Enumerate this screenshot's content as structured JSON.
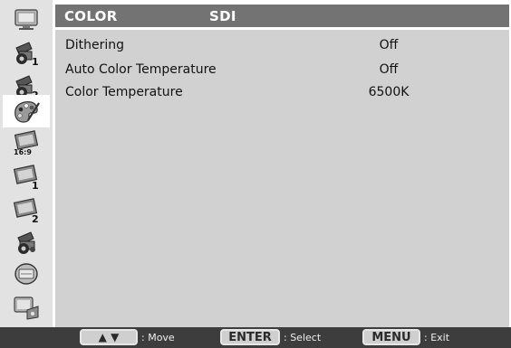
{
  "header": {
    "title": "COLOR",
    "source": "SDI"
  },
  "settings": [
    {
      "label": "Dithering",
      "value": "Off"
    },
    {
      "label": "Auto Color Temperature",
      "value": "Off"
    },
    {
      "label": "Color Temperature",
      "value": "6500K"
    }
  ],
  "sidebar": {
    "items": [
      {
        "icon": "monitor-icon",
        "badge": ""
      },
      {
        "icon": "camera-settings-icon",
        "badge": "1"
      },
      {
        "icon": "camera-settings-icon",
        "badge": "2"
      },
      {
        "icon": "color-palette-icon",
        "badge": "",
        "active": true
      },
      {
        "icon": "aspect-ratio-icon",
        "badge": "16:9"
      },
      {
        "icon": "picture-icon",
        "badge": "1"
      },
      {
        "icon": "picture-icon",
        "badge": "2"
      },
      {
        "icon": "film-camera-icon",
        "badge": ""
      },
      {
        "icon": "display-mode-icon",
        "badge": ""
      },
      {
        "icon": "system-icon",
        "badge": ""
      }
    ]
  },
  "footer": {
    "move_key": "▲ ▼",
    "move_label": ": Move",
    "select_key": "ENTER",
    "select_label": ": Select",
    "menu_key": "MENU",
    "exit_label": ": Exit"
  },
  "colors": {
    "header_bg": "#737373",
    "content_bg": "#d1d1d1",
    "sidebar_bg": "#e2e2e2",
    "footer_bg": "#3d3d3d"
  }
}
